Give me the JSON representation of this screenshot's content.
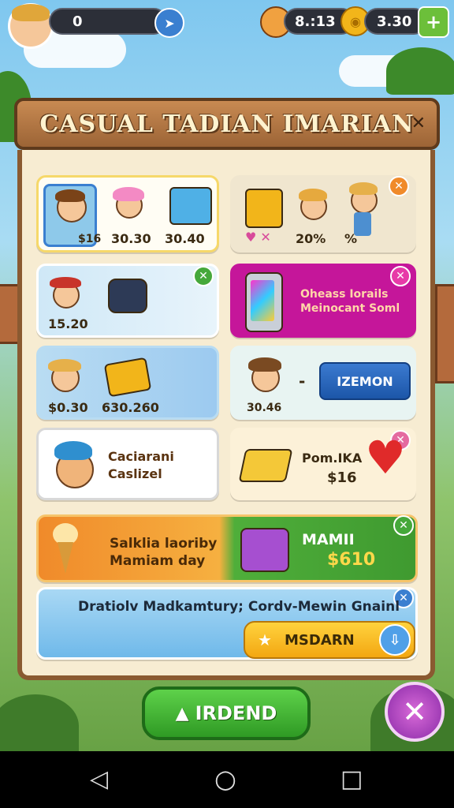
{
  "hud": {
    "level_value": "0",
    "timer_value": "8.:13",
    "coins_value": "3.30",
    "plus_label": "+",
    "colors": {
      "pill": "#2c2f38",
      "plus": "#6cbf3a",
      "coin": "#f2b51a"
    }
  },
  "panel": {
    "title": "CASUAL TADIAN IMARIAN",
    "close_glyph": "✕"
  },
  "cards": {
    "c1": {
      "labels": [
        "$16",
        "30.30",
        "30.40"
      ]
    },
    "c2": {
      "labels": [
        "20%",
        "%"
      ]
    },
    "c3": {
      "label": "15.20"
    },
    "c4": {
      "text_line1": "Oheass Iorails",
      "text_line2": "Meinocant Soml"
    },
    "c5": {
      "labels": [
        "$0.30",
        "630.260"
      ]
    },
    "c6": {
      "label": "30.46",
      "dash": "-",
      "button_label": "IZEMON"
    },
    "c7": {
      "text_line1": "Caciarani",
      "text_line2": "Caslizel"
    },
    "c8": {
      "text_line1": "Pom.IKA",
      "text_line2": "$16"
    },
    "c9": {
      "text_line1": "Salklia laoriby",
      "text_line2": "Mamiam day",
      "right_line1": "MAMII",
      "right_line2": "$610"
    },
    "c10": {
      "text": "Dratiolv Madkamtury; Cordv-Mewin Gnainl",
      "button_label": "MSDARN"
    }
  },
  "bottom": {
    "main_button_label": "IRDEND",
    "close_glyph": "✕"
  },
  "nav": {
    "back": "◁",
    "home": "○",
    "recent": "□"
  }
}
